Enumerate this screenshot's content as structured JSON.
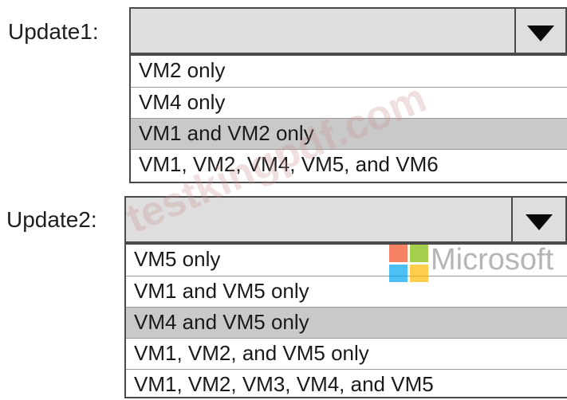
{
  "update1": {
    "label": "Update1:",
    "selected_value": "",
    "options": [
      "VM2 only",
      "VM4 only",
      "VM1 and VM2 only",
      "VM1, VM2, VM4, VM5, and VM6"
    ],
    "highlighted_option": "VM1 and VM2 only"
  },
  "update2": {
    "label": "Update2:",
    "selected_value": "",
    "options": [
      "VM5 only",
      "VM1 and VM5 only",
      "VM4 and VM5 only",
      "VM1, VM2, and VM5 only",
      "VM1, VM2, VM3, VM4, and VM5"
    ],
    "highlighted_option": "VM4 and VM5 only"
  },
  "icons": {
    "dropdown_arrow": "triangle-down-icon"
  },
  "colors": {
    "dropdown_bg": "#dedede",
    "highlight_bg": "#c9c9c9",
    "border": "#4a4a4a",
    "logo_red": "#f25022",
    "logo_green": "#7fba00",
    "logo_blue": "#00a4ef",
    "logo_yellow": "#ffb900"
  },
  "watermark": {
    "text": "testkingpdf.com"
  },
  "brand": {
    "text": "Microsoft"
  }
}
